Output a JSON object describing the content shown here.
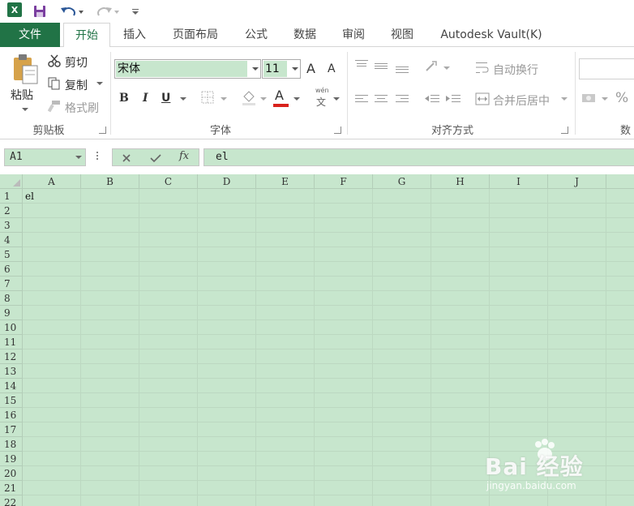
{
  "qat": {
    "app_icon": "excel-icon",
    "save_icon": "save-icon",
    "undo_icon": "undo-icon",
    "redo_icon": "redo-icon",
    "customize_icon": "chevron-down-icon"
  },
  "tabs": [
    {
      "label": "文件"
    },
    {
      "label": "开始"
    },
    {
      "label": "插入"
    },
    {
      "label": "页面布局"
    },
    {
      "label": "公式"
    },
    {
      "label": "数据"
    },
    {
      "label": "审阅"
    },
    {
      "label": "视图"
    },
    {
      "label": "Autodesk Vault(K)"
    }
  ],
  "ribbon": {
    "clipboard": {
      "paste_label": "粘贴",
      "cut_label": "剪切",
      "copy_label": "复制",
      "format_painter_label": "格式刷",
      "group_label": "剪贴板"
    },
    "font": {
      "font_name": "宋体",
      "font_size": "11",
      "grow_label": "A",
      "shrink_label": "A",
      "bold_label": "B",
      "italic_label": "I",
      "underline_label": "U",
      "font_color_label": "A",
      "font_color": "#d9221c",
      "phonetic_top": "wén",
      "phonetic_bottom": "文",
      "group_label": "字体"
    },
    "alignment": {
      "wrap_text_label": "自动换行",
      "merge_center_label": "合并后居中",
      "group_label": "对齐方式"
    },
    "number": {
      "percent_label": "%",
      "group_label": "数"
    }
  },
  "formula_bar": {
    "name_box": "A1",
    "cancel_icon": "close-icon",
    "enter_icon": "check-icon",
    "fx_label": "fx",
    "content": "el"
  },
  "sheet": {
    "columns": [
      "A",
      "B",
      "C",
      "D",
      "E",
      "F",
      "G",
      "H",
      "I",
      "J"
    ],
    "rows": [
      "1",
      "2",
      "3",
      "4",
      "5",
      "6",
      "7",
      "8",
      "9",
      "10",
      "11",
      "12",
      "13",
      "14",
      "15",
      "16",
      "17",
      "18",
      "19",
      "20",
      "21",
      "22"
    ],
    "cell_a1": "el",
    "background": "#c7e6cd"
  },
  "watermark": {
    "brand": "Bai 经验",
    "url": "jingyan.baidu.com"
  },
  "colors": {
    "excel_green": "#217346",
    "sheet_green": "#c7e6cd"
  }
}
